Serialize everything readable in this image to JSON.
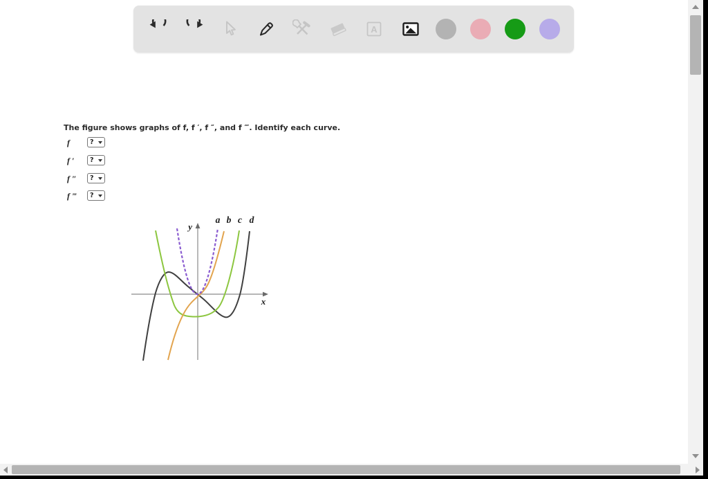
{
  "toolbar": {
    "tools": [
      "undo",
      "redo",
      "select-cursor",
      "pen",
      "settings-tools",
      "eraser",
      "text-tool",
      "image-tool"
    ],
    "tool_states": {
      "undo": "enabled",
      "redo": "enabled",
      "select-cursor": "disabled",
      "pen": "enabled",
      "settings-tools": "disabled",
      "eraser": "disabled",
      "text-tool": "disabled",
      "image-tool": "enabled"
    },
    "text_tool_glyph": "A",
    "swatches": [
      {
        "name": "gray",
        "color": "#b3b3b3"
      },
      {
        "name": "pink",
        "color": "#eaacb5"
      },
      {
        "name": "green",
        "color": "#169b16"
      },
      {
        "name": "lavender",
        "color": "#b7abe9"
      }
    ]
  },
  "question": {
    "text": "The figure shows graphs of f, f ′, f ″, and f ‴. Identify each curve."
  },
  "answers": [
    {
      "label": "f",
      "value": "?"
    },
    {
      "label": "f ′",
      "value": "?"
    },
    {
      "label": "f ″",
      "value": "?"
    },
    {
      "label": "f ‴",
      "value": "?"
    }
  ],
  "figure": {
    "x_label": "x",
    "y_label": "y",
    "curve_labels": [
      "a",
      "b",
      "c",
      "d"
    ],
    "curves": [
      {
        "label": "a",
        "color": "#8a5cd0",
        "style": "dashed",
        "shape": "narrow parabola opening upward, vertex at origin"
      },
      {
        "label": "b",
        "color": "#e2a44e",
        "style": "solid",
        "shape": "increasing S-shaped cubic passing through origin"
      },
      {
        "label": "c",
        "color": "#8cc63f",
        "style": "solid",
        "shape": "wide quartic-like curve with flat minimum below x-axis"
      },
      {
        "label": "d",
        "color": "#3f3f3f",
        "style": "solid",
        "shape": "cubic with local max left of y-axis and local min right of y-axis"
      }
    ]
  }
}
